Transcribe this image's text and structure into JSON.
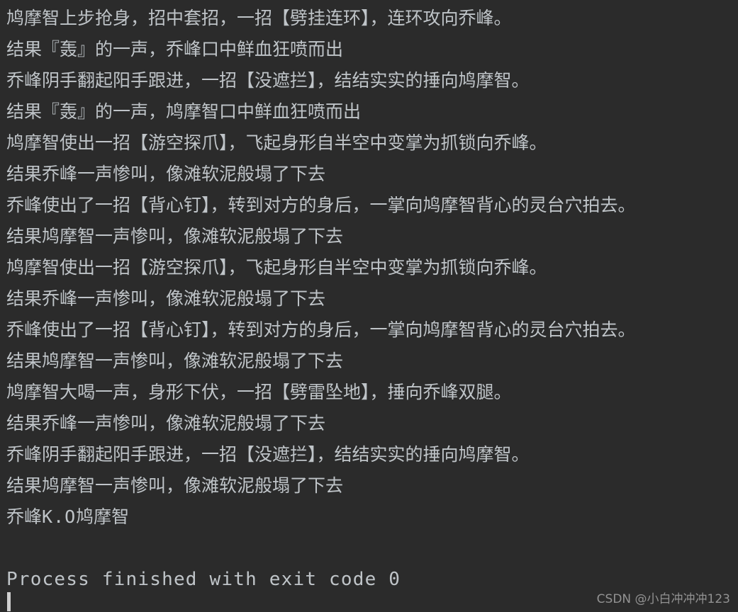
{
  "console": {
    "background_color": "#2b2b2b",
    "text_color": "#bfc4c8",
    "caret_color": "#cfcfcf",
    "lines": [
      {
        "id": "line-1",
        "text": "鸠摩智上步抢身，招中套招，一招【劈挂连环】，连环攻向乔峰。"
      },
      {
        "id": "line-2",
        "text": "结果『轰』的一声，乔峰口中鲜血狂喷而出"
      },
      {
        "id": "line-3",
        "text": "乔峰阴手翻起阳手跟进，一招【没遮拦】，结结实实的捶向鸠摩智。"
      },
      {
        "id": "line-4",
        "text": "结果『轰』的一声，鸠摩智口中鲜血狂喷而出"
      },
      {
        "id": "line-5",
        "text": "鸠摩智使出一招【游空探爪】，飞起身形自半空中变掌为抓锁向乔峰。"
      },
      {
        "id": "line-6",
        "text": "结果乔峰一声惨叫，像滩软泥般塌了下去"
      },
      {
        "id": "line-7",
        "text": "乔峰使出了一招【背心钉】，转到对方的身后，一掌向鸠摩智背心的灵台穴拍去。"
      },
      {
        "id": "line-8",
        "text": "结果鸠摩智一声惨叫，像滩软泥般塌了下去"
      },
      {
        "id": "line-9",
        "text": "鸠摩智使出一招【游空探爪】，飞起身形自半空中变掌为抓锁向乔峰。"
      },
      {
        "id": "line-10",
        "text": "结果乔峰一声惨叫，像滩软泥般塌了下去"
      },
      {
        "id": "line-11",
        "text": "乔峰使出了一招【背心钉】，转到对方的身后，一掌向鸠摩智背心的灵台穴拍去。"
      },
      {
        "id": "line-12",
        "text": "结果鸠摩智一声惨叫，像滩软泥般塌了下去"
      },
      {
        "id": "line-13",
        "text": "鸠摩智大喝一声，身形下伏，一招【劈雷坠地】，捶向乔峰双腿。"
      },
      {
        "id": "line-14",
        "text": "结果乔峰一声惨叫，像滩软泥般塌了下去"
      },
      {
        "id": "line-15",
        "text": "乔峰阴手翻起阳手跟进，一招【没遮拦】，结结实实的捶向鸠摩智。"
      },
      {
        "id": "line-16",
        "text": "结果鸠摩智一声惨叫，像滩软泥般塌了下去"
      }
    ],
    "result_line": {
      "winner": "乔峰",
      "ko": "K.O",
      "loser": "鸠摩智"
    },
    "exit_message": "Process finished with exit code 0"
  },
  "watermark": {
    "text": "CSDN @小白冲冲冲123"
  }
}
